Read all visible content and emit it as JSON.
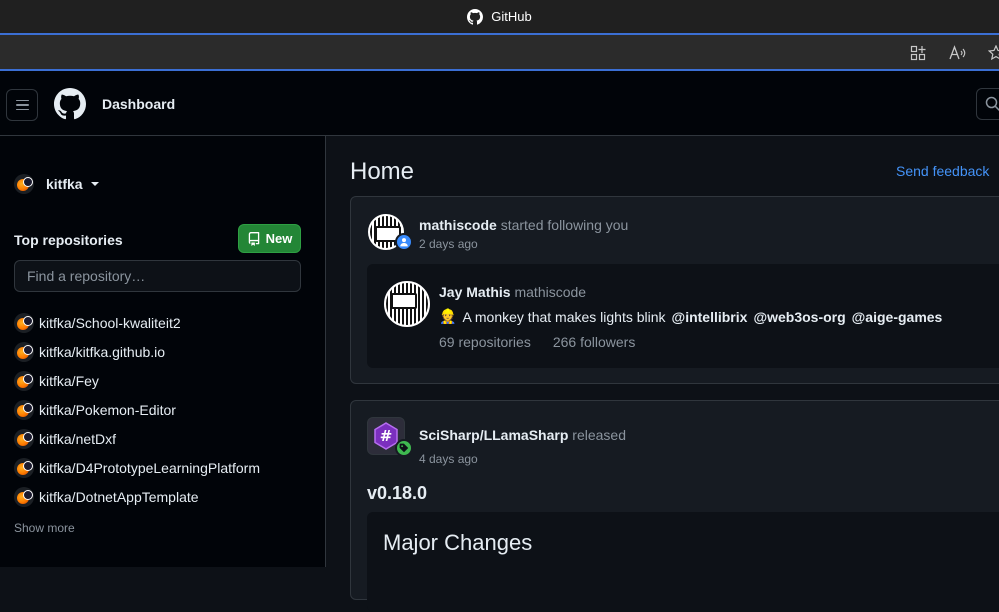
{
  "browser": {
    "title": "GitHub"
  },
  "header": {
    "title": "Dashboard"
  },
  "sidebar": {
    "username": "kitfka",
    "top_repos_label": "Top repositories",
    "new_label": "New",
    "find_placeholder": "Find a repository…",
    "repos": [
      "kitfka/School-kwaliteit2",
      "kitfka/kitfka.github.io",
      "kitfka/Fey",
      "kitfka/Pokemon-Editor",
      "kitfka/netDxf",
      "kitfka/D4PrototypeLearningPlatform",
      "kitfka/DotnetAppTemplate"
    ],
    "show_more": "Show more"
  },
  "main": {
    "title": "Home",
    "send_feedback": "Send feedback",
    "follow_event": {
      "actor": "mathiscode",
      "action": "started following you",
      "time": "2 days ago",
      "profile": {
        "full_name": "Jay Mathis",
        "login": "mathiscode",
        "bio_emoji": "👷",
        "bio_text": "A monkey that makes lights blink",
        "mentions": [
          "@intellibrix",
          "@web3os-org",
          "@aige-games"
        ],
        "repositories": "69 repositories",
        "followers": "266 followers"
      }
    },
    "release_event": {
      "actor": "SciSharp/LLamaSharp",
      "action": "released",
      "time": "4 days ago",
      "version": "v0.18.0",
      "heading": "Major Changes"
    }
  }
}
